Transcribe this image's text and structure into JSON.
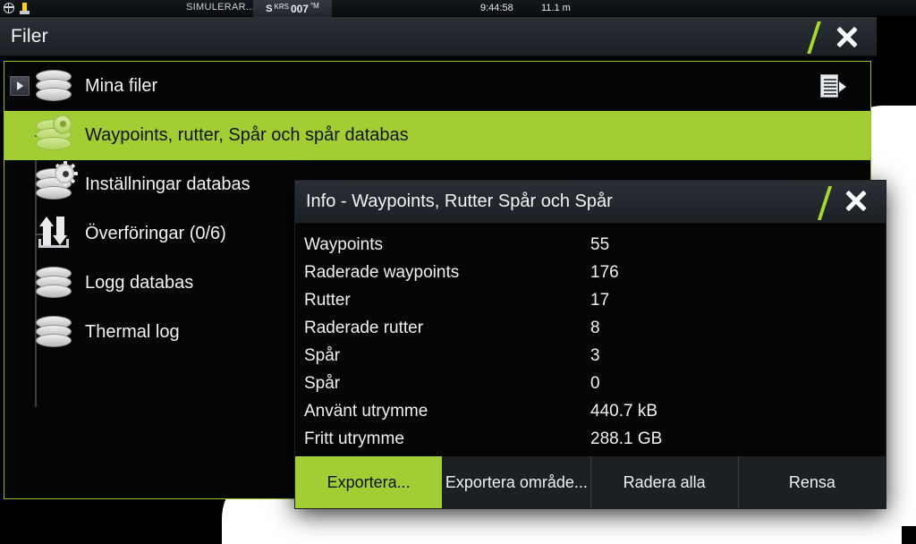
{
  "statusbar": {
    "globe_icon": "globe-icon",
    "marker_icon": "buoy-icon",
    "simulator": "SIMULERAR...",
    "heading_prefix": "S",
    "heading_label": "KRS",
    "heading_value": "007",
    "heading_unit": "°M",
    "time": "9:44:58",
    "depth": "11.1 m"
  },
  "window": {
    "title": "Filer",
    "close_label": "×"
  },
  "file_tree": {
    "menu_icon": "list-menu-icon",
    "items": [
      {
        "label": "Mina filer",
        "icon": "database-icon",
        "selected": false,
        "expander": true
      },
      {
        "label": "Waypoints, rutter, Spår och spår databas",
        "icon": "waypoint-database-icon",
        "selected": true,
        "expander": false
      },
      {
        "label": "Inställningar databas",
        "icon": "settings-database-icon",
        "selected": false,
        "expander": false
      },
      {
        "label": "Överföringar (0/6)",
        "icon": "transfer-arrows-icon",
        "selected": false,
        "expander": false
      },
      {
        "label": "Logg databas",
        "icon": "database-icon",
        "selected": false,
        "expander": false
      },
      {
        "label": "Thermal log",
        "icon": "database-icon",
        "selected": false,
        "expander": false
      }
    ]
  },
  "info_dialog": {
    "title": "Info - Waypoints, Rutter Spår och Spår",
    "close_label": "×",
    "rows": [
      {
        "key": "Waypoints",
        "value": "55"
      },
      {
        "key": "Raderade waypoints",
        "value": "176"
      },
      {
        "key": "Rutter",
        "value": "17"
      },
      {
        "key": "Raderade rutter",
        "value": "8"
      },
      {
        "key": "Spår",
        "value": "3"
      },
      {
        "key": "Spår",
        "value": "0"
      },
      {
        "key": "Använt utrymme",
        "value": "440.7 kB"
      },
      {
        "key": "Fritt utrymme",
        "value": "288.1 GB"
      }
    ],
    "buttons": [
      {
        "label": "Exportera...",
        "primary": true
      },
      {
        "label": "Exportera område...",
        "primary": false
      },
      {
        "label": "Radera alla",
        "primary": false
      },
      {
        "label": "Rensa",
        "primary": false
      }
    ]
  },
  "colors": {
    "accent_green": "#a2ce33",
    "panel_border": "#8fbf2a",
    "background": "#050505",
    "titlebar": "#2b3036",
    "bezel": "#ffffff"
  }
}
